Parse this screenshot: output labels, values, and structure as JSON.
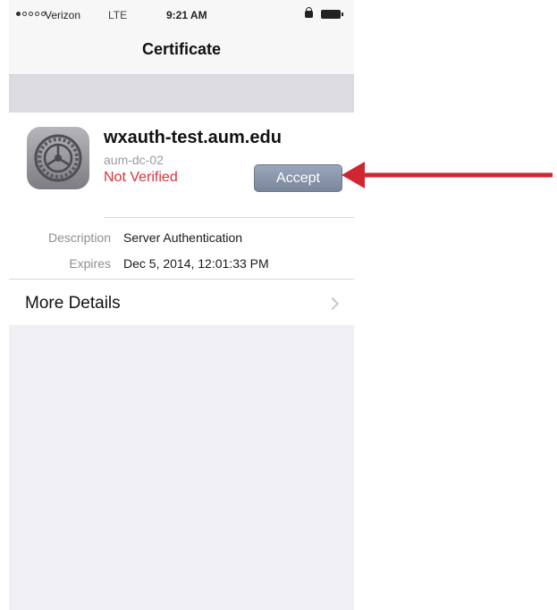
{
  "status_bar": {
    "carrier": "Verizon",
    "network": "LTE",
    "time": "9:21 AM",
    "signal_bars_filled": 1,
    "signal_bars_total": 5
  },
  "nav": {
    "title": "Certificate"
  },
  "certificate": {
    "name": "wxauth-test.aum.edu",
    "issuer": "aum-dc-02",
    "status": "Not Verified",
    "status_color": "#e0303a",
    "icon": "settings-gear-icon"
  },
  "actions": {
    "accept_label": "Accept"
  },
  "details": [
    {
      "label": "Description",
      "value": "Server Authentication"
    },
    {
      "label": "Expires",
      "value": "Dec 5, 2014, 12:01:33 PM"
    }
  ],
  "more_details": {
    "label": "More Details"
  },
  "annotation": {
    "arrow_color": "#d02631",
    "points_to": "accept-button"
  }
}
